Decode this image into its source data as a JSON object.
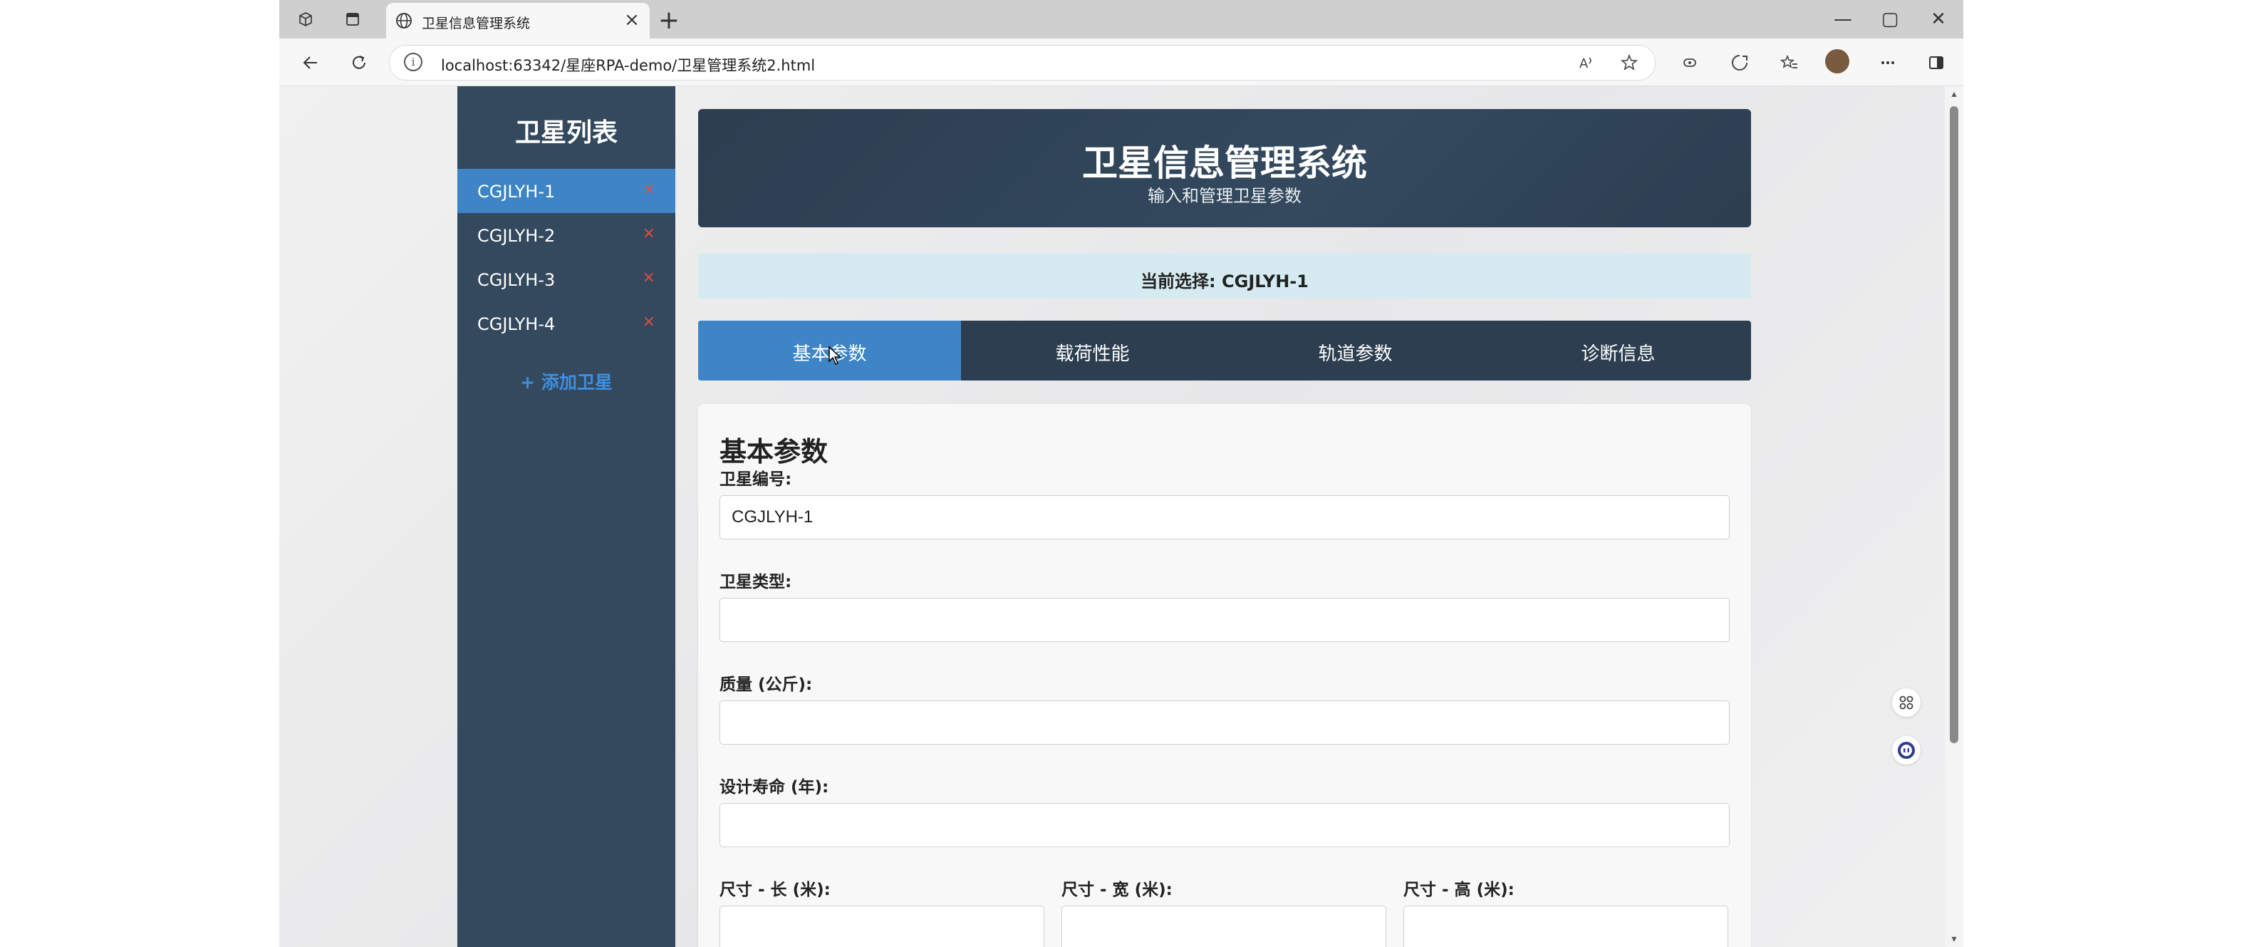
{
  "browser": {
    "tab_title": "卫星信息管理系统",
    "url": "localhost:63342/星座RPA-demo/卫星管理系统2.html",
    "new_tab_label": "+",
    "close_tab_label": "×",
    "window_controls": {
      "minimize": "—",
      "maximize": "▢",
      "close": "✕"
    },
    "icons": [
      "workspaces-icon",
      "tab-actions-icon",
      "globe-icon",
      "back-icon",
      "refresh-icon",
      "info-icon",
      "read-aloud-icon",
      "favorite-icon",
      "extension-icon",
      "browser-essentials-icon",
      "favorites-bar-icon",
      "profile-avatar",
      "more-icon",
      "sidebar-toggle-icon"
    ]
  },
  "sidebar": {
    "title": "卫星列表",
    "items": [
      {
        "label": "CGJLYH-1",
        "delete": "×",
        "active": true
      },
      {
        "label": "CGJLYH-2",
        "delete": "×",
        "active": false
      },
      {
        "label": "CGJLYH-3",
        "delete": "×",
        "active": false
      },
      {
        "label": "CGJLYH-4",
        "delete": "×",
        "active": false
      }
    ],
    "add_label": "+ 添加卫星"
  },
  "header": {
    "title": "卫星信息管理系统",
    "subtitle": "输入和管理卫星参数"
  },
  "current_selection": "当前选择: CGJLYH-1",
  "tabs": [
    {
      "label": "基本参数",
      "active": true
    },
    {
      "label": "载荷性能",
      "active": false
    },
    {
      "label": "轨道参数",
      "active": false
    },
    {
      "label": "诊断信息",
      "active": false
    }
  ],
  "panel": {
    "title": "基本参数",
    "fields": {
      "id": {
        "label": "卫星编号:",
        "value": "CGJLYH-1"
      },
      "type": {
        "label": "卫星类型:",
        "value": ""
      },
      "mass": {
        "label": "质量 (公斤):",
        "value": ""
      },
      "life": {
        "label": "设计寿命 (年):",
        "value": ""
      },
      "length": {
        "label": "尺寸 - 长 (米):",
        "value": ""
      },
      "width": {
        "label": "尺寸 - 宽 (米):",
        "value": ""
      },
      "height": {
        "label": "尺寸 - 高 (米):",
        "value": ""
      }
    }
  },
  "colors": {
    "sidebar_bg": "#34495e",
    "accent": "#3d85c6",
    "header_bg": "#2c3e50",
    "delete_red": "#e74c3c",
    "selection_bg": "#d6ebf1"
  }
}
